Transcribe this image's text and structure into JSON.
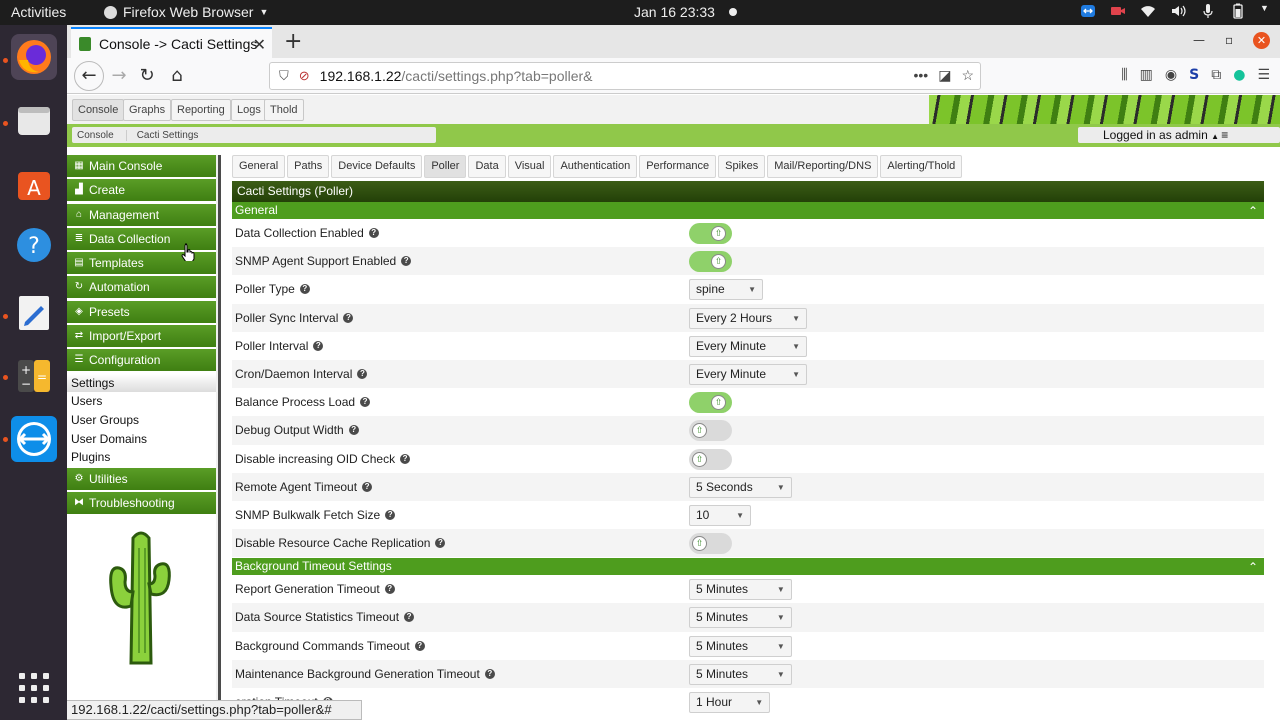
{
  "os": {
    "activities": "Activities",
    "app_name": "Firefox Web Browser",
    "clock": "Jan 16  23:33"
  },
  "browser": {
    "tab_title": "Console -> Cacti Settings",
    "url_host": "192.168.1.22",
    "url_path": "/cacti/settings.php?tab=poller&",
    "status_url": "192.168.1.22/cacti/settings.php?tab=poller&#"
  },
  "cacti": {
    "top_tabs": [
      "Console",
      "Graphs",
      "Reporting",
      "Logs",
      "Thold"
    ],
    "breadcrumbs": [
      "Console",
      "Cacti Settings"
    ],
    "login_status": "Logged in as admin",
    "menu": {
      "main_console": "Main Console",
      "create": "Create",
      "management": "Management",
      "data_collection": "Data Collection",
      "templates": "Templates",
      "automation": "Automation",
      "presets": "Presets",
      "import_export": "Import/Export",
      "configuration": "Configuration",
      "config_items": [
        "Settings",
        "Users",
        "User Groups",
        "User Domains",
        "Plugins"
      ],
      "utilities": "Utilities",
      "troubleshooting": "Troubleshooting"
    },
    "settings_tabs": [
      "General",
      "Paths",
      "Device Defaults",
      "Poller",
      "Data",
      "Visual",
      "Authentication",
      "Performance",
      "Spikes",
      "Mail/Reporting/DNS",
      "Alerting/Thold"
    ],
    "active_settings_tab": "Poller",
    "panel_title": "Cacti Settings (Poller)",
    "sections": {
      "general": {
        "title": "General",
        "rows": [
          {
            "label": "Data Collection Enabled",
            "type": "toggle",
            "on": true
          },
          {
            "label": "SNMP Agent Support Enabled",
            "type": "toggle",
            "on": true
          },
          {
            "label": "Poller Type",
            "type": "select",
            "value": "spine"
          },
          {
            "label": "Poller Sync Interval",
            "type": "select",
            "value": "Every 2 Hours"
          },
          {
            "label": "Poller Interval",
            "type": "select",
            "value": "Every Minute"
          },
          {
            "label": "Cron/Daemon Interval",
            "type": "select",
            "value": "Every Minute"
          },
          {
            "label": "Balance Process Load",
            "type": "toggle",
            "on": true
          },
          {
            "label": "Debug Output Width",
            "type": "toggle",
            "on": false
          },
          {
            "label": "Disable increasing OID Check",
            "type": "toggle",
            "on": false
          },
          {
            "label": "Remote Agent Timeout",
            "type": "select",
            "value": "5 Seconds"
          },
          {
            "label": "SNMP Bulkwalk Fetch Size",
            "type": "select",
            "value": "10"
          },
          {
            "label": "Disable Resource Cache Replication",
            "type": "toggle",
            "on": false
          }
        ]
      },
      "background": {
        "title": "Background Timeout Settings",
        "rows": [
          {
            "label": "Report Generation Timeout",
            "type": "select",
            "value": "5 Minutes"
          },
          {
            "label": "Data Source Statistics Timeout",
            "type": "select",
            "value": "5 Minutes"
          },
          {
            "label": "Background Commands Timeout",
            "type": "select",
            "value": "5 Minutes"
          },
          {
            "label": "Maintenance Background Generation Timeout",
            "type": "select",
            "value": "5 Minutes"
          },
          {
            "label": "eration Timeout",
            "type": "select",
            "value": "1 Hour"
          }
        ]
      }
    }
  },
  "icons": {
    "collapse": "chevrons-up-icon",
    "help": "help-circle-icon"
  },
  "colors": {
    "menu_green": "#4e9d1e",
    "panel_dark_green": "#2f4f10",
    "toggle_on": "#8fd16a",
    "ubuntu_orange": "#e95420"
  }
}
